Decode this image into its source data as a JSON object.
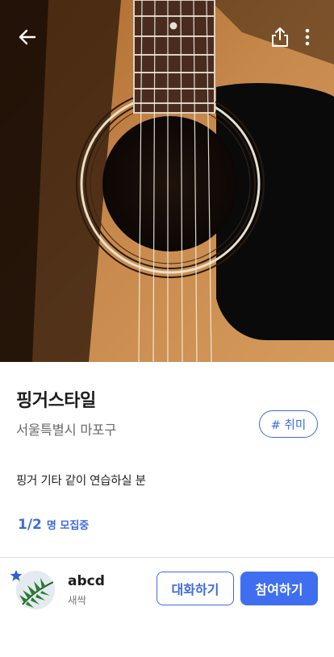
{
  "hero": {
    "image_icon": "acoustic-guitar-photo",
    "back_icon": "arrow-left-icon",
    "share_icon": "share-icon",
    "more_icon": "more-vertical-icon"
  },
  "post": {
    "title": "핑거스타일",
    "location": "서울특별시 마포구",
    "tag": "# 취미",
    "description": "핑거 기타 같이 연습하실 분",
    "recruit_count": "1/2",
    "recruit_label": "명 모집중"
  },
  "host": {
    "name": "abcd",
    "level": "새싹",
    "avatar_icon": "palm-leaf-avatar",
    "badge_icon": "star-badge-icon"
  },
  "actions": {
    "chat_label": "대화하기",
    "join_label": "참여하기"
  },
  "colors": {
    "accent": "#3d6bde",
    "join_button": "#3f6ff0"
  }
}
